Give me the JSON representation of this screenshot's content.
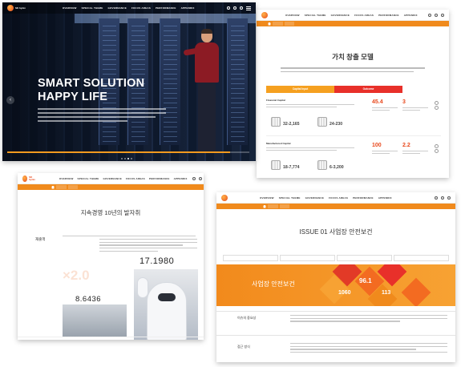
{
  "nav": {
    "menu": [
      "OVERVIEW",
      "SPECIAL THEME",
      "GOVERNANCE",
      "FOCUS AREAS",
      "PERFORMANCE",
      "APPENDIX"
    ],
    "logo_text": "SK hynix"
  },
  "hero": {
    "title_line1": "SMART SOLUTION",
    "title_line2": "HAPPY LIFE",
    "prev_arrow": "‹",
    "progress_pct": 92,
    "slide_count": 4,
    "active_slide": 2
  },
  "value_model": {
    "title": "가치 창출 모델",
    "tab_input": "Capital Input",
    "tab_outcome": "Outcome",
    "row1_label": "Financial Capital",
    "row1_fig1": "32-2,165",
    "row1_fig2": "24-230",
    "row1_stat1": "45.4",
    "row1_stat2": "3",
    "row2_label": "Manufactured Capital",
    "row2_fig1": "18-7,774",
    "row2_fig2": "6-3,200",
    "row2_stat1": "100",
    "row2_stat2": "2.2"
  },
  "history": {
    "title": "지속경영 10년의 발자취",
    "side_label": "재출액",
    "big1": "17.1980",
    "ghost": "×2.0",
    "big2": "8.6436"
  },
  "issue": {
    "title": "ISSUE 01 사업장 안전보건",
    "band_title": "사업장 안전보건",
    "num_a": "96.1",
    "num_b": "1060",
    "num_c": "113",
    "section1": "이슈의 중요성",
    "section2": "접근 방식"
  },
  "colors": {
    "accent": "#f08a1c",
    "red": "#e8302a",
    "brand": "#e8491d"
  }
}
